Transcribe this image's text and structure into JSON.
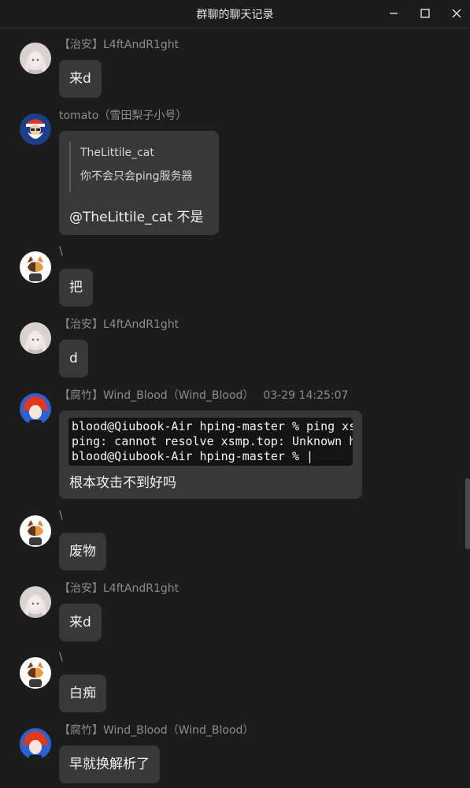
{
  "window": {
    "title": "群聊的聊天记录"
  },
  "icons": {
    "minimize": "minimize-icon",
    "maximize": "maximize-icon",
    "close": "close-icon"
  },
  "messages": [
    {
      "sender": "【治安】L4ftAndR1ght",
      "text": "来d",
      "avatar": "anime-girl-avatar"
    },
    {
      "sender": "tomato（雪田梨子小号）",
      "quote_name": "TheLittile_cat",
      "quote_text": "你不会只会ping服务器",
      "text": "@TheLittile_cat 不是",
      "avatar": "santa-avatar"
    },
    {
      "sender": "\\",
      "text": "把",
      "avatar": "cat-avatar"
    },
    {
      "sender": "【治安】L4ftAndR1ght",
      "text": "d",
      "avatar": "anime-girl-avatar"
    },
    {
      "sender": "【腐竹】Wind_Blood（Wind_Blood）",
      "time": "03-29 14:25:07",
      "code_lines": [
        "blood@Qiubook-Air hping-master % ping xsmp.top",
        "ping: cannot resolve xsmp.top: Unknown host",
        "blood@Qiubook-Air hping-master % |"
      ],
      "text": "根本攻击不到好吗",
      "avatar": "red-hair-avatar"
    },
    {
      "sender": "\\",
      "text": "废物",
      "avatar": "cat-avatar"
    },
    {
      "sender": "【治安】L4ftAndR1ght",
      "text": "来d",
      "avatar": "anime-girl-avatar"
    },
    {
      "sender": "\\",
      "text": "白痴",
      "avatar": "cat-avatar"
    },
    {
      "sender": "【腐竹】Wind_Blood（Wind_Blood）",
      "text": "早就换解析了",
      "avatar": "red-hair-avatar"
    }
  ]
}
